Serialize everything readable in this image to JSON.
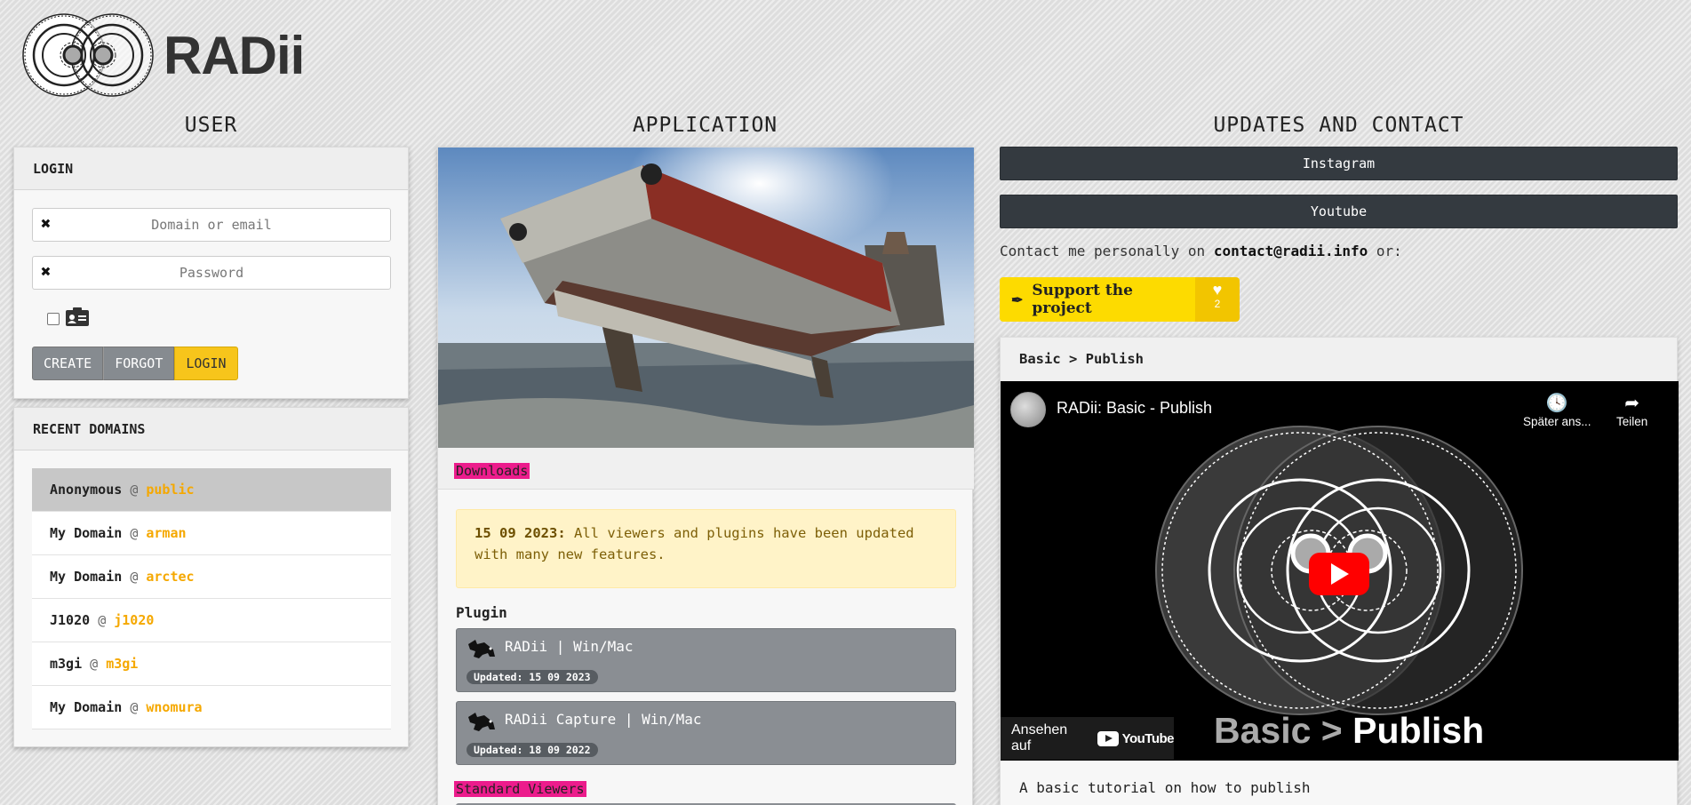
{
  "brand": {
    "name": "RADii"
  },
  "columns": {
    "user": "USER",
    "application": "APPLICATION",
    "updates": "UPDATES AND CONTACT"
  },
  "login": {
    "header": "LOGIN",
    "domain_placeholder": "Domain or email",
    "password_placeholder": "Password",
    "create": "CREATE",
    "forgot": "FORGOT",
    "login": "LOGIN"
  },
  "recent": {
    "header": "RECENT DOMAINS",
    "items": [
      {
        "name": "Anonymous",
        "at": "@",
        "user": "public"
      },
      {
        "name": "My Domain",
        "at": "@",
        "user": "arman"
      },
      {
        "name": "My Domain",
        "at": "@",
        "user": "arctec"
      },
      {
        "name": "J1020",
        "at": "@",
        "user": "j1020"
      },
      {
        "name": "m3gi",
        "at": "@",
        "user": "m3gi"
      },
      {
        "name": "My Domain",
        "at": "@",
        "user": "wnomura"
      }
    ]
  },
  "app": {
    "downloads_label": "Downloads",
    "notice_date": "15 09 2023:",
    "notice_text": "All viewers and plugins have been updated with many new features.",
    "plugin_heading": "Plugin",
    "plugins": [
      {
        "name": "RADii | Win/Mac",
        "updated": "Updated: 15 09 2023"
      },
      {
        "name": "RADii Capture | Win/Mac",
        "updated": "Updated: 18 09 2022"
      }
    ],
    "viewers_label": "Standard Viewers"
  },
  "updates": {
    "instagram": "Instagram",
    "youtube": "Youtube",
    "contact_prefix": "Contact me personally on",
    "contact_email": "contact@radii.info",
    "contact_suffix": "or:",
    "support_label": "Support the project",
    "support_count": "2",
    "video_card_title": "Basic > Publish",
    "video": {
      "title": "RADii: Basic - Publish",
      "watch_later": "Später ans...",
      "share": "Teilen",
      "watch_on": "Ansehen auf",
      "youtube_logo": "YouTube",
      "big_title_dim": "Basic >",
      "big_title": "Publish"
    },
    "video_description": "A basic tutorial on how to publish"
  },
  "colors": {
    "accent_yellow": "#f7c51b",
    "pink_tag": "#ec1c8c",
    "dark_button": "#343a40",
    "domain_user": "#f5a800"
  }
}
